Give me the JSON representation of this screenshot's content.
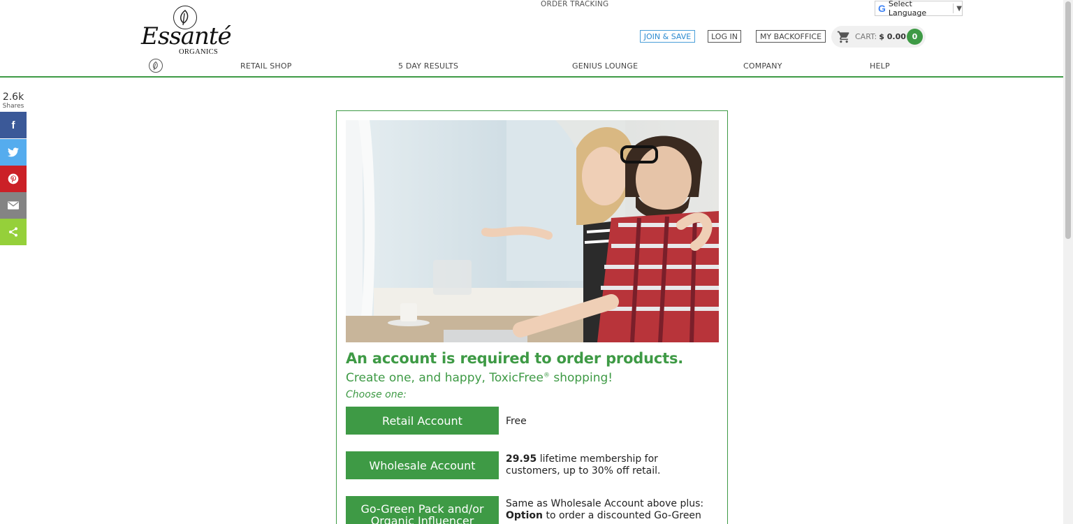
{
  "header": {
    "order_tracking": "ORDER TRACKING",
    "language_select": "Select Language",
    "logo_script": "Essanté",
    "logo_subtitle": "ORGANICS",
    "join_label": "JOIN & SAVE",
    "login_label": "LOG IN",
    "backoffice_label": "MY BACKOFFICE",
    "cart_label": "CART:",
    "cart_amount": "$ 0.00",
    "cart_count": "0"
  },
  "nav": {
    "items": [
      {
        "label": "RETAIL SHOP"
      },
      {
        "label": "5 DAY RESULTS"
      },
      {
        "label": "GENIUS LOUNGE"
      },
      {
        "label": "COMPANY"
      },
      {
        "label": "HELP"
      }
    ]
  },
  "share": {
    "count": "2.6k",
    "count_label": "Shares",
    "colors": {
      "facebook": "#3b5998",
      "twitter": "#55acee",
      "pinterest": "#cb2027",
      "email": "#848484",
      "share": "#95d03a"
    }
  },
  "main": {
    "headline": "An account is required to order products.",
    "subhead": "Create one, and happy, ToxicFree",
    "subhead_mark": "®",
    "subhead_end": " shopping!",
    "choose": "Choose one:",
    "accounts": [
      {
        "label": "Retail Account",
        "desc": "Free"
      },
      {
        "label": "Wholesale Account",
        "desc_bold": "29.95",
        "desc": " lifetime membership for customers, up to 30% off retail."
      },
      {
        "label": "Go-Green Pack and/or Organic Influencer",
        "desc": "Same as Wholesale Account above plus:",
        "desc_bold": "Option",
        "desc2": " to order a discounted Go-Green"
      }
    ]
  },
  "theme": {
    "accent": "#3e9a45",
    "link": "#2b8ad0"
  }
}
